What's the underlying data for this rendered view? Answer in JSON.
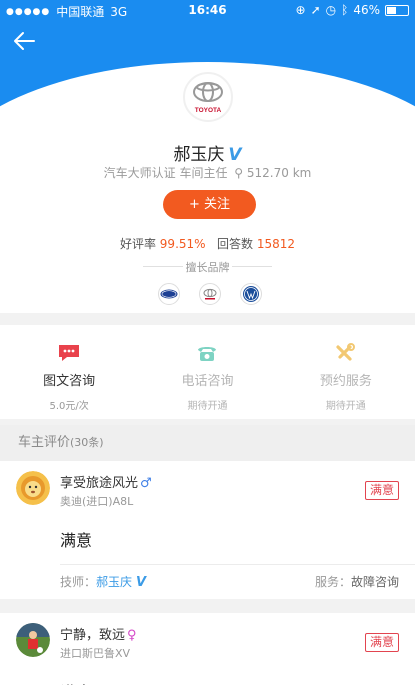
{
  "status_bar": {
    "carrier": "中国联通",
    "network": "3G",
    "time": "16:46",
    "battery": "46%",
    "battery_level": 0.46
  },
  "profile": {
    "brand_logo_text": "TOYOTA",
    "name": "郝玉庆",
    "verified_badge": "V",
    "certification": "汽车大师认证 车间主任",
    "distance": "512.70 km",
    "follow_label": "+ 关注",
    "rating_label": "好评率",
    "rating_value": "99.51%",
    "answers_label": "回答数",
    "answers_value": "15812",
    "brands_title": "擅长品牌",
    "brands": [
      "Ford",
      "Toyota",
      "Volkswagen"
    ]
  },
  "services": [
    {
      "title": "图文咨询",
      "sub": "5.0元/次",
      "icon": "chat-bubble-icon",
      "color": "#e9424c"
    },
    {
      "title": "电话咨询",
      "sub": "期待开通",
      "icon": "phone-icon",
      "color": "#7ed3c3"
    },
    {
      "title": "预约服务",
      "sub": "期待开通",
      "icon": "wrench-icon",
      "color": "#f2c872"
    }
  ],
  "reviews": {
    "header": "车主评价",
    "count": "(30条)",
    "items": [
      {
        "name": "享受旅途风光",
        "gender": "♂",
        "car": "奥迪(进口)A8L",
        "tag": "满意",
        "content": "满意",
        "tech_label": "技师：",
        "tech_name": "郝玉庆",
        "tech_badge": "V",
        "service_label": "服务：",
        "service_value": "故障咨询"
      },
      {
        "name": "宁静，致远",
        "gender": "♀",
        "car": "进口斯巴鲁XV",
        "tag": "满意",
        "content": "满意"
      }
    ]
  },
  "colors": {
    "header_blue": "#1a8cf0",
    "accent_orange": "#f25a20",
    "verified_blue": "#3b9be6",
    "tag_red": "#e2444f"
  }
}
